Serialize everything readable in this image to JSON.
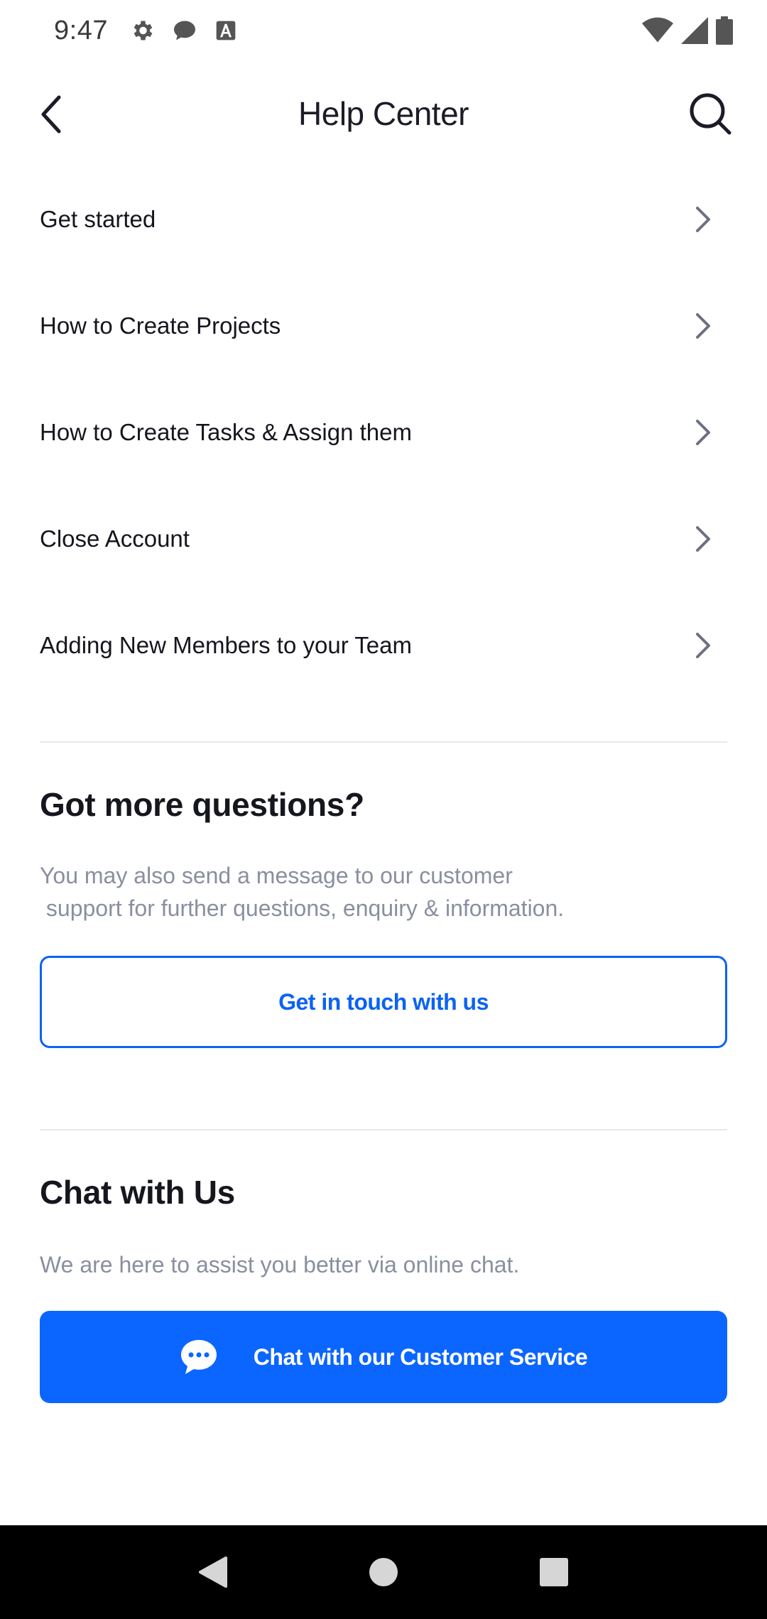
{
  "status_bar": {
    "time": "9:47",
    "left_icons": [
      "gear-icon",
      "chat-bubble-icon",
      "font-icon"
    ],
    "right_icons": [
      "wifi-icon",
      "signal-icon",
      "battery-icon"
    ]
  },
  "header": {
    "title": "Help Center",
    "back_icon": "chevron-left-icon",
    "search_icon": "search-icon"
  },
  "topics": [
    {
      "label": "Get started"
    },
    {
      "label": "How to Create Projects"
    },
    {
      "label": "How to Create Tasks & Assign them"
    },
    {
      "label": "Close Account"
    },
    {
      "label": "Adding New Members to your Team"
    }
  ],
  "questions": {
    "title": "Got more questions?",
    "text": "You may also send a message to our customer\n support for further questions, enquiry & information.",
    "button_label": "Get in touch with us"
  },
  "chat": {
    "title": "Chat with Us",
    "text": "We are here to assist you better via online chat.",
    "button_label": "Chat with our Customer Service",
    "button_icon": "chat-dots-icon"
  },
  "colors": {
    "accent": "#0b66ff",
    "muted_text": "#8a8f9f",
    "divider": "#e6e8ef",
    "nav_bar": "#000000"
  },
  "nav_bar": {
    "buttons": [
      "back-triangle-icon",
      "home-circle-icon",
      "recents-square-icon"
    ]
  }
}
